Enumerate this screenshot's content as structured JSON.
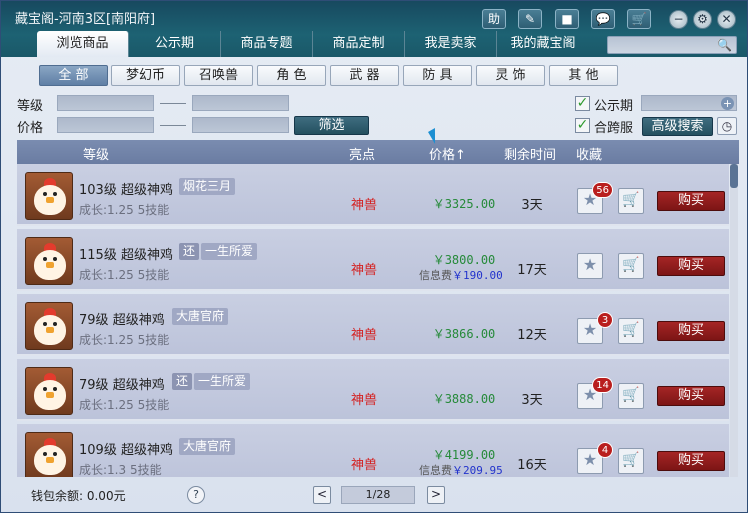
{
  "window": {
    "title": "藏宝阁-河南3区[南阳府]"
  },
  "titlebar_buttons": [
    {
      "label": "助",
      "icon": "help-char-icon"
    },
    {
      "label": "",
      "icon": "edit-icon"
    },
    {
      "label": "",
      "icon": "stop-icon"
    },
    {
      "label": "",
      "icon": "chat-icon"
    },
    {
      "label": "",
      "icon": "cart-icon"
    }
  ],
  "window_controls": [
    {
      "icon": "minimize-icon"
    },
    {
      "icon": "settings-icon"
    },
    {
      "icon": "close-icon"
    }
  ],
  "tabs": [
    {
      "label": "浏览商品",
      "active": true
    },
    {
      "label": "公示期"
    },
    {
      "label": "商品专题"
    },
    {
      "label": "商品定制"
    },
    {
      "label": "我是卖家"
    },
    {
      "label": "我的藏宝阁"
    }
  ],
  "search": {
    "placeholder": ""
  },
  "categories": [
    "全 部",
    "梦幻币",
    "召唤兽",
    "角 色",
    "武 器",
    "防 具",
    "灵 饰",
    "其 他"
  ],
  "filters": {
    "level_label": "等级",
    "price_label": "价格",
    "filter_button": "筛选",
    "public_label": "公示期",
    "cross_server_label": "合跨服",
    "advanced_search": "高级搜索"
  },
  "table": {
    "headers": [
      "等级",
      "亮点",
      "价格↑",
      "剩余时间",
      "收藏"
    ],
    "rows": [
      {
        "level": "103级",
        "name": "超级神鸡",
        "tags": [
          "烟花三月"
        ],
        "growth": "成长:1.25 5技能",
        "highlight": "神兽",
        "price": "￥3325.00",
        "fee_label": "",
        "fee": "",
        "time": "3天",
        "fav_count": "56",
        "buy": "购买"
      },
      {
        "level": "115级",
        "name": "超级神鸡",
        "tags": [
          "还",
          "一生所爱"
        ],
        "growth": "成长:1.25 5技能",
        "highlight": "神兽",
        "price": "￥3800.00",
        "fee_label": "信息费",
        "fee": "￥190.00",
        "time": "17天",
        "fav_count": "",
        "buy": "购买"
      },
      {
        "level": "79级",
        "name": "超级神鸡",
        "tags": [
          "大唐官府"
        ],
        "growth": "成长:1.25 5技能",
        "highlight": "神兽",
        "price": "￥3866.00",
        "fee_label": "",
        "fee": "",
        "time": "12天",
        "fav_count": "3",
        "buy": "购买"
      },
      {
        "level": "79级",
        "name": "超级神鸡",
        "tags": [
          "还",
          "一生所爱"
        ],
        "growth": "成长:1.25 5技能",
        "highlight": "神兽",
        "price": "￥3888.00",
        "fee_label": "",
        "fee": "",
        "time": "3天",
        "fav_count": "14",
        "buy": "购买"
      },
      {
        "level": "109级",
        "name": "超级神鸡",
        "tags": [
          "大唐官府"
        ],
        "growth": "成长:1.3 5技能",
        "highlight": "神兽",
        "price": "￥4199.00",
        "fee_label": "信息费",
        "fee": "￥209.95",
        "time": "16天",
        "fav_count": "4",
        "buy": "购买"
      }
    ]
  },
  "footer": {
    "wallet": "钱包余额: 0.00元",
    "help": "?",
    "prev": "<",
    "next": ">",
    "page": "1/28"
  },
  "colors": {
    "titlebar": "#1d6273",
    "header": "#7a8cb0",
    "buy": "#a52525",
    "price": "#268a3a",
    "highlight": "#d42222"
  }
}
